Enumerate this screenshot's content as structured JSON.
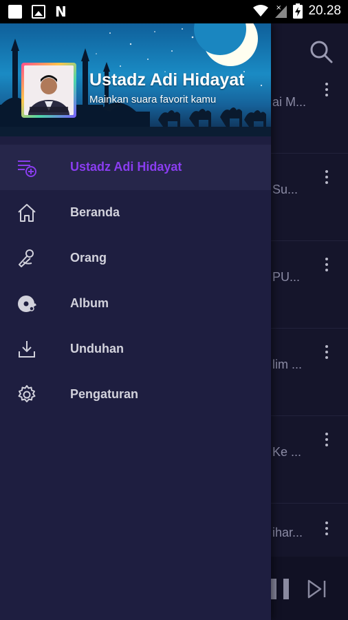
{
  "status_bar": {
    "time": "20.28",
    "left_icons": [
      "notification-square-icon",
      "image-icon",
      "n-app-icon"
    ],
    "right_icons": [
      "wifi-icon",
      "signal-off-icon",
      "battery-charging-icon"
    ]
  },
  "drawer": {
    "header": {
      "title": "Ustadz Adi Hidayat",
      "subtitle": "Mainkan suara favorit kamu",
      "avatar_caption": "Ustadz Adi Hidayat"
    },
    "items": [
      {
        "label": "Ustadz Adi Hidayat",
        "icon": "playlist-add-icon",
        "active": true
      },
      {
        "label": "Beranda",
        "icon": "home-icon",
        "active": false
      },
      {
        "label": "Orang",
        "icon": "artist-icon",
        "active": false
      },
      {
        "label": "Album",
        "icon": "album-icon",
        "active": false
      },
      {
        "label": "Unduhan",
        "icon": "download-icon",
        "active": false
      },
      {
        "label": "Pengaturan",
        "icon": "settings-icon",
        "active": false
      }
    ]
  },
  "background_list": {
    "rows": [
      {
        "title_fragment": "ai M..."
      },
      {
        "title_fragment": "Su..."
      },
      {
        "title_fragment": "PU..."
      },
      {
        "title_fragment": "lim ..."
      },
      {
        "title_fragment": "Ke ..."
      },
      {
        "title_fragment": "ihar..."
      }
    ]
  },
  "colors": {
    "drawer_bg": "#1e1e40",
    "active_item_bg": "#26264a",
    "accent": "#8a3df0",
    "menu_text": "#d2d2dc"
  }
}
